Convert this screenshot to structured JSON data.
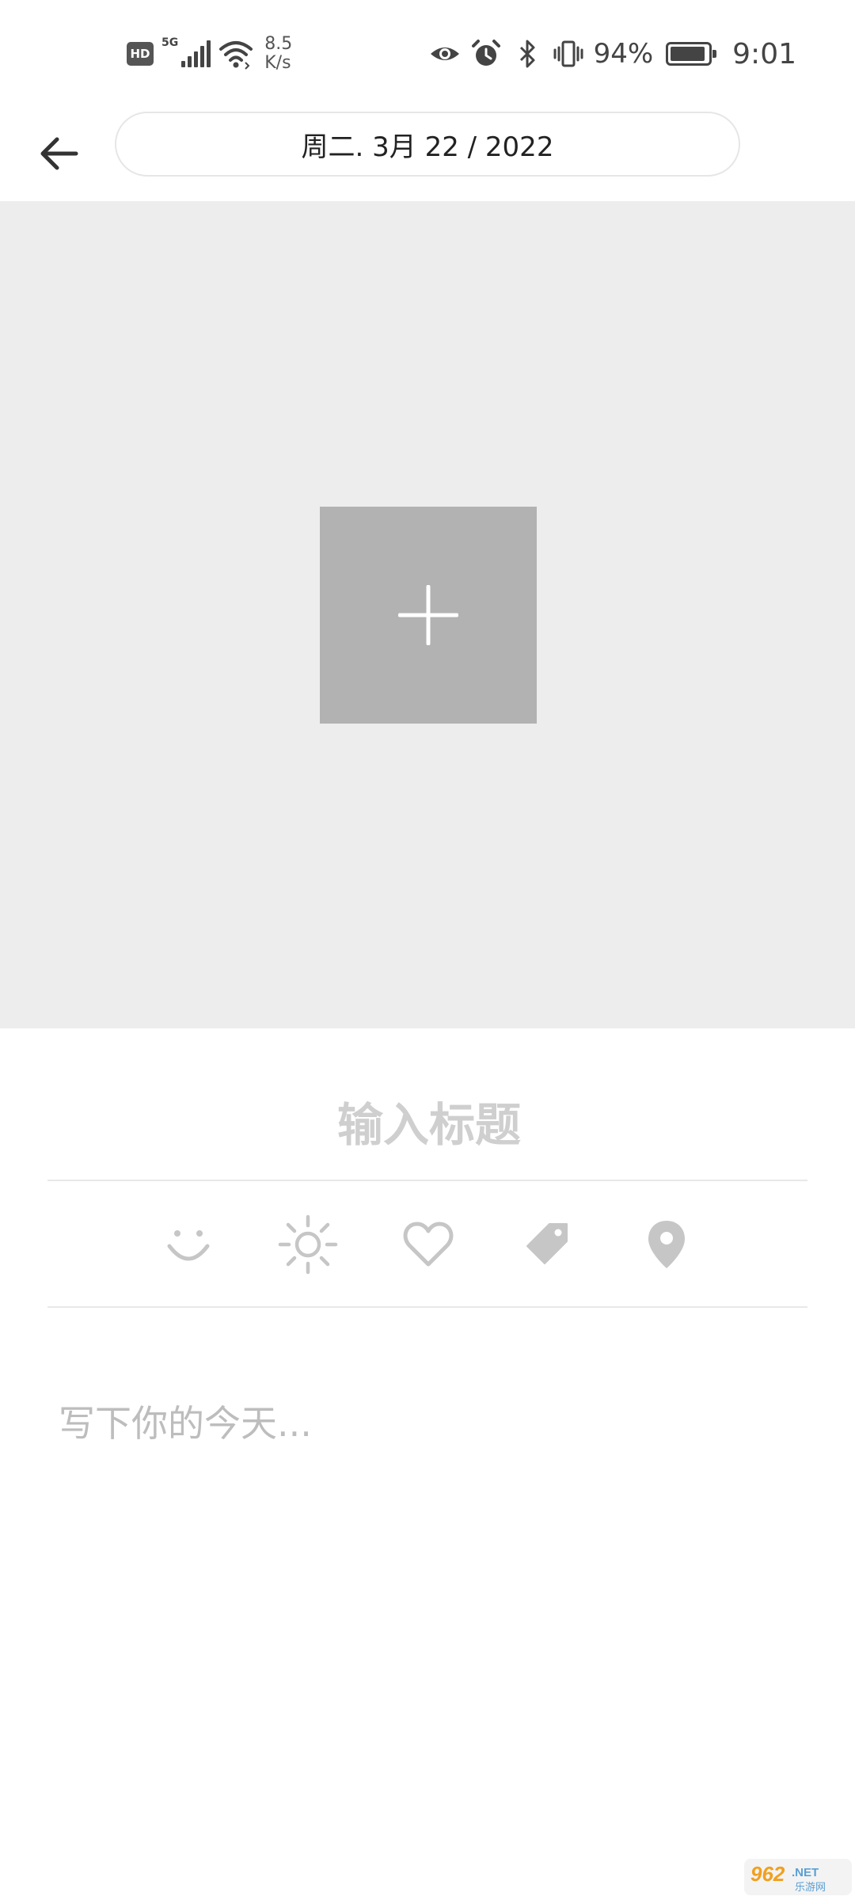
{
  "status_bar": {
    "hd": "HD",
    "network": "5G",
    "speed_value": "8.5",
    "speed_unit": "K/s",
    "battery_pct": "94%",
    "battery_level": 0.94,
    "time": "9:01"
  },
  "header": {
    "date": "周二. 3月 22 / 2022"
  },
  "editor": {
    "title_placeholder": "输入标题",
    "body_placeholder": "写下你的今天..."
  },
  "toolbar": {
    "icons": [
      "mood-icon",
      "weather-icon",
      "heart-icon",
      "tag-icon",
      "location-icon"
    ]
  },
  "colors": {
    "cover_bg": "#ededed",
    "add_tile": "#b2b2b2",
    "toolbar_icon": "#c6c6c6",
    "placeholder": "#cfcfcf"
  },
  "watermark": {
    "brand": "962.NET",
    "sub": "乐游网"
  }
}
